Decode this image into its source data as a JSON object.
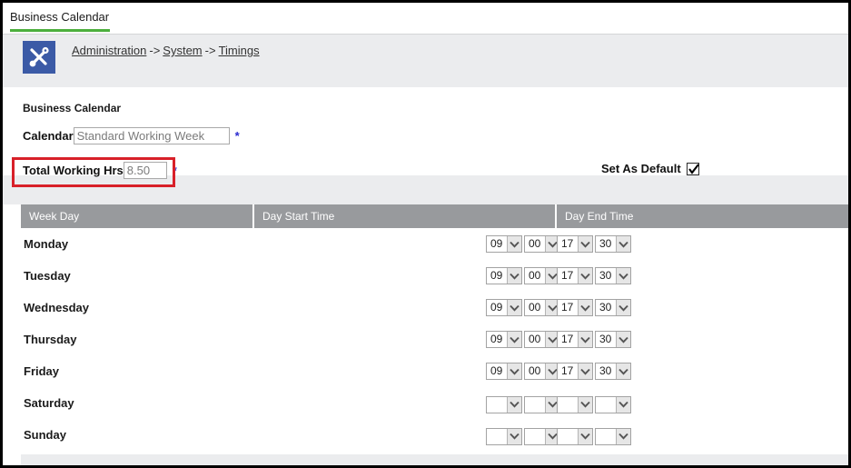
{
  "window": {
    "tab_label": "Business Calendar",
    "accent_color": "#4caf3d"
  },
  "breadcrumb": {
    "icon": "tools-icon",
    "items": [
      "Administration",
      "System",
      "Timings"
    ],
    "separator": "->"
  },
  "form": {
    "section_title": "Business Calendar",
    "calendar_label": "Calendar",
    "calendar_value": "Standard Working Week",
    "calendar_required_marker": "*",
    "total_hours_label": "Total Working Hrs",
    "total_hours_value": "8.50",
    "total_hours_required_marker": "*",
    "set_as_default_label": "Set As Default",
    "set_as_default_checked": "checked",
    "highlight_color": "#d82029",
    "required_marker_color": "#2b2bd0"
  },
  "table": {
    "headers": [
      "Week Day",
      "Day Start Time",
      "Day End Time"
    ],
    "rows": [
      {
        "day": "Monday",
        "start_hour": "09",
        "start_minute": "00",
        "end_hour": "17",
        "end_minute": "30"
      },
      {
        "day": "Tuesday",
        "start_hour": "09",
        "start_minute": "00",
        "end_hour": "17",
        "end_minute": "30"
      },
      {
        "day": "Wednesday",
        "start_hour": "09",
        "start_minute": "00",
        "end_hour": "17",
        "end_minute": "30"
      },
      {
        "day": "Thursday",
        "start_hour": "09",
        "start_minute": "00",
        "end_hour": "17",
        "end_minute": "30"
      },
      {
        "day": "Friday",
        "start_hour": "09",
        "start_minute": "00",
        "end_hour": "17",
        "end_minute": "30"
      },
      {
        "day": "Saturday",
        "start_hour": "",
        "start_minute": "",
        "end_hour": "",
        "end_minute": ""
      },
      {
        "day": "Sunday",
        "start_hour": "",
        "start_minute": "",
        "end_hour": "",
        "end_minute": ""
      }
    ]
  }
}
